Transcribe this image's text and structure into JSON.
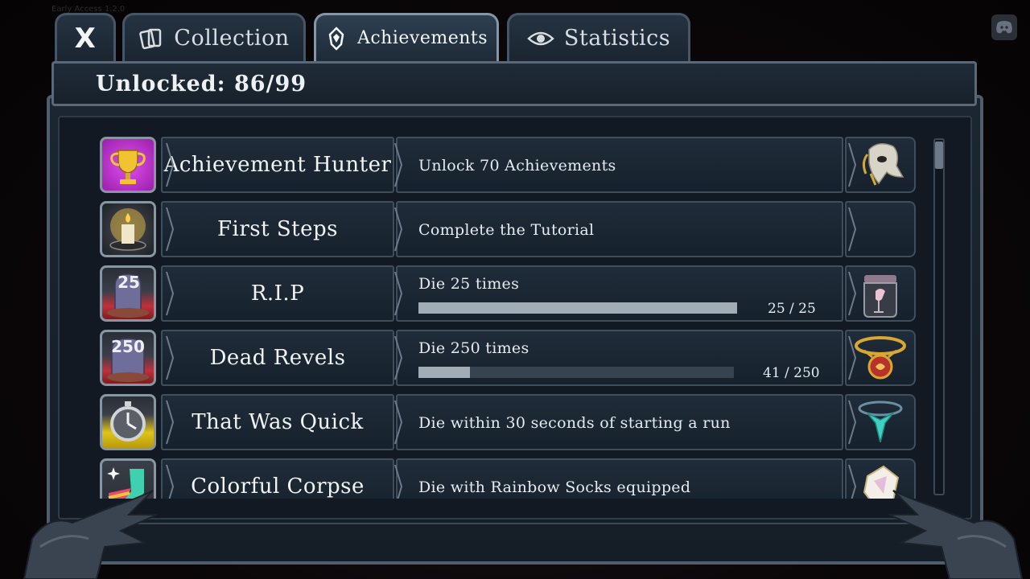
{
  "build_text": "Early Access 1.2.0",
  "tabs": {
    "close_label": "X",
    "collection_label": "Collection",
    "achievements_label": "Achievements",
    "statistics_label": "Statistics"
  },
  "header": {
    "unlocked_label": "Unlocked: 86/99"
  },
  "achievements": [
    {
      "name": "Achievement Hunter",
      "description": "Unlock 70 Achievements",
      "icon": "trophy-icon",
      "reward": "bird-skull-mask"
    },
    {
      "name": "First Steps",
      "description": "Complete the Tutorial",
      "icon": "candle-icon",
      "reward": ""
    },
    {
      "name": "R.I.P",
      "description": "Die 25 times",
      "icon": "tombstone-icon",
      "badge": "25",
      "progress_text": "25 / 25",
      "progress": 1.0,
      "reward": "jar-bird"
    },
    {
      "name": "Dead Revels",
      "description": "Die 250 times",
      "icon": "tombstone-icon",
      "badge": "250",
      "progress_text": "41 / 250",
      "progress": 0.164,
      "reward": "gold-necklace"
    },
    {
      "name": "That Was Quick",
      "description": "Die within 30 seconds of starting a run",
      "icon": "stopwatch-icon",
      "reward": "teal-amulet"
    },
    {
      "name": "Colorful Corpse",
      "description": "Die with Rainbow Socks equipped",
      "icon": "rainbow-sock-icon",
      "reward": "crystal-cube"
    }
  ],
  "colors": {
    "panel": "#1a2430",
    "border": "#4f5d6c",
    "progress_fill": "#a3acb4",
    "progress_track": "#37444f",
    "trophy_bg": "#c02fd0",
    "tombstone_bg": "#c0303a",
    "stopwatch_bg": "#e0c418"
  }
}
